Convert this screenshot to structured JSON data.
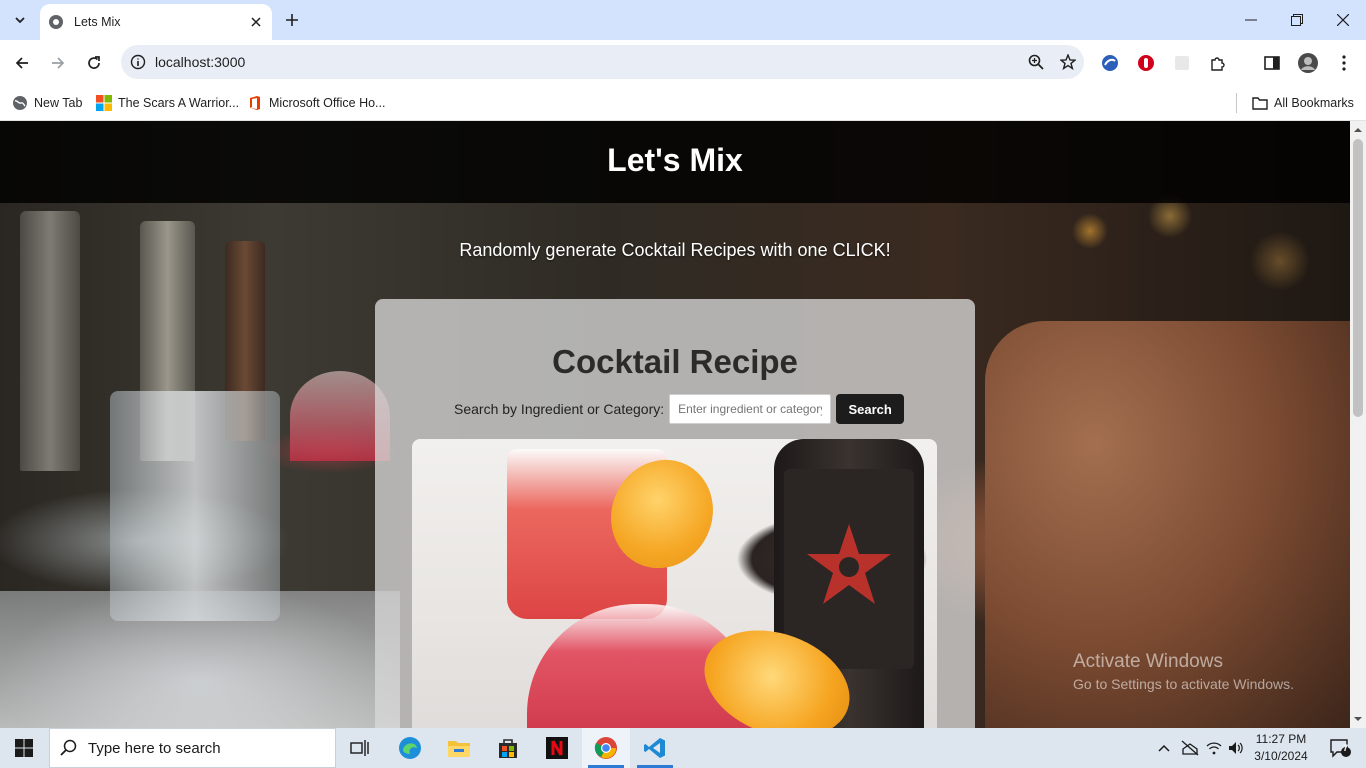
{
  "browser": {
    "tab_title": "Lets Mix",
    "url": "localhost:3000",
    "bookmarks": [
      {
        "label": "New Tab"
      },
      {
        "label": "The Scars A Warrior..."
      },
      {
        "label": "Microsoft Office Ho..."
      }
    ],
    "all_bookmarks_label": "All Bookmarks"
  },
  "page": {
    "site_title": "Let's Mix",
    "tagline": "Randomly generate Cocktail Recipes with one CLICK!",
    "card_title": "Cocktail Recipe",
    "search_label": "Search by Ingredient or Category:",
    "search_placeholder": "Enter ingredient or category",
    "search_value": "",
    "search_button": "Search",
    "watermark": {
      "line1": "Activate Windows",
      "line2": "Go to Settings to activate Windows."
    }
  },
  "taskbar": {
    "search_placeholder": "Type here to search",
    "time": "11:27 PM",
    "date": "3/10/2024",
    "notification_count": "7"
  },
  "colors": {
    "tabstrip": "#d3e3fd",
    "header_bg": "#000000",
    "search_button": "#1c1c1c",
    "taskbar": "#dde5ee"
  },
  "icons": [
    "tab-search-icon",
    "lets-mix-favicon",
    "tab-close-icon",
    "new-tab-plus-icon",
    "minimize-icon",
    "restore-icon",
    "window-close-icon",
    "back-arrow-icon",
    "forward-arrow-icon",
    "reload-icon",
    "site-info-icon",
    "zoom-icon",
    "bookmark-star-icon",
    "extensions-puzzle-icon",
    "side-panel-icon",
    "profile-avatar",
    "kebab-menu-icon",
    "windows-start-icon",
    "magnifier-icon",
    "task-view-icon",
    "edge-icon",
    "file-explorer-icon",
    "store-icon",
    "netflix-icon",
    "chrome-icon",
    "vscode-icon",
    "chevron-up-icon",
    "network-icon",
    "wifi-icon",
    "volume-icon",
    "notification-icon"
  ]
}
